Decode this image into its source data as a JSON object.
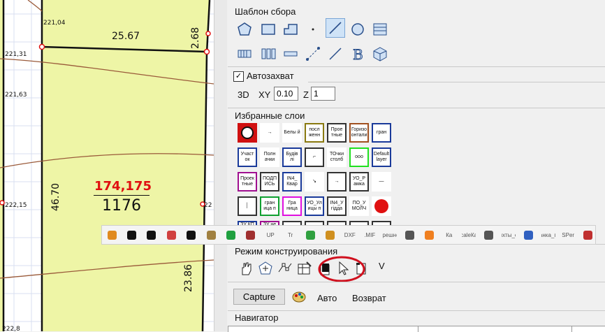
{
  "map": {
    "elevations": [
      "221,04",
      "221,31",
      "221,63",
      "222,15",
      "222,8",
      "22"
    ],
    "dims": [
      "25.67",
      "2.68",
      "46.70",
      "23.86"
    ],
    "parcel_id": "174,175",
    "parcel_area": "1176",
    "colors": {
      "parcel_fill": "#eef5a6",
      "red": "#e01010",
      "contour": "#9a5a3a"
    }
  },
  "panel": {
    "template_title": "Шаблон сбора",
    "autosnap_label": "Автозахват",
    "autosnap_checked": true,
    "label_3d": "3D",
    "label_xy": "XY",
    "xy_value": "0.10",
    "label_z": "Z",
    "z_value": "1",
    "fav_title": "Избранные слои",
    "fav_layers": [
      [
        "",
        "→",
        "Белы й",
        "посл женн",
        "Прое тные",
        "Горизо онтали",
        "гран"
      ],
      [
        "Участ ок",
        "Полн ачки",
        "Будів лі",
        "⌐",
        "ТОчки столб",
        "ооо",
        "Default layer"
      ],
      [
        "Проек тные",
        "ПОДП ИСЬ",
        "IN4_ Квар",
        "↘",
        "→",
        "УО_Р амка",
        "—"
      ],
      [
        "│",
        "гран ица п",
        "Гра ница",
        "УО_Ул ицы п",
        "IN4_У гідда",
        "ПО_У МОЛЧ",
        "●"
      ],
      [
        "ЗУ КП",
        "ЗУ не",
        "",
        "",
        "",
        "",
        ""
      ]
    ],
    "mode_title": "Режим конструирования",
    "mode_last": "V",
    "capture_label": "Capture",
    "auto_label": "Авто",
    "return_label": "Возврат",
    "nav_title": "Навигатор"
  },
  "floatbar": {
    "items": [
      "",
      "",
      "",
      "",
      "",
      "",
      "",
      "",
      "UP",
      "Tr",
      "",
      "",
      "DXF",
      ".MIF",
      "трешно",
      "",
      "",
      "Ка",
      "саlеКа",
      "",
      "ихты_е",
      "",
      "анка_п",
      "SPer",
      ""
    ]
  }
}
